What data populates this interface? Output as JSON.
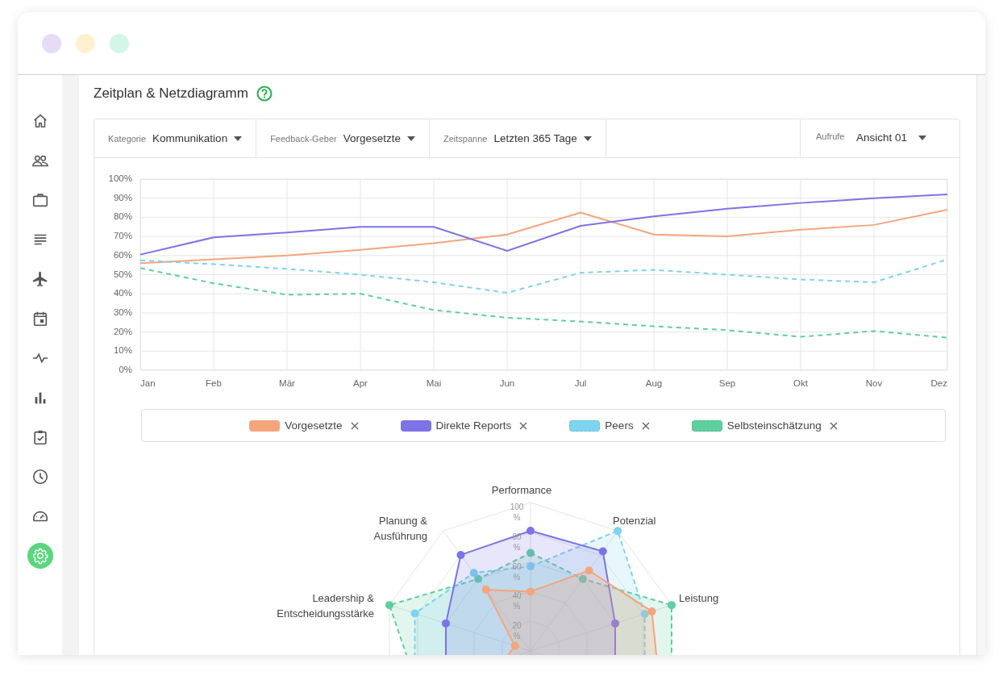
{
  "sidebar": {
    "items": [
      {
        "selected": false
      },
      {
        "selected": false
      },
      {
        "selected": false
      },
      {
        "selected": false
      },
      {
        "selected": false
      },
      {
        "selected": false
      },
      {
        "selected": false
      },
      {
        "selected": false
      },
      {
        "selected": false
      },
      {
        "selected": false
      },
      {
        "selected": false
      },
      {
        "selected": true
      }
    ]
  },
  "section": {
    "title": "Zeitplan & Netzdiagramm"
  },
  "filters": [
    {
      "label": "Kategorie",
      "value": "Kommunikation"
    },
    {
      "label": "Feedback-Geber",
      "value": "Vorgesetzte"
    },
    {
      "label": "Zeitspanne",
      "value": "Letzten 365 Tage"
    }
  ],
  "view_select": {
    "label": "Aufrufe",
    "value": "Ansicht 01"
  },
  "timeline": {
    "chart_data": {
      "type": "line",
      "categories": [
        "Jan",
        "Feb",
        "Mär",
        "Apr",
        "Mai",
        "Jun",
        "Jul",
        "Aug",
        "Sep",
        "Okt",
        "Nov",
        "Dez"
      ],
      "ylim": [
        0,
        100
      ],
      "grid": true,
      "yticks": [
        {
          "value": 0,
          "label": "0%"
        },
        {
          "value": 10,
          "label": "10%"
        },
        {
          "value": 20,
          "label": "20%"
        },
        {
          "value": 30,
          "label": "30%"
        },
        {
          "value": 40,
          "label": "40%"
        },
        {
          "value": 50,
          "label": "50%"
        },
        {
          "value": 60,
          "label": "60%"
        },
        {
          "value": 70,
          "label": "70%"
        },
        {
          "value": 80,
          "label": "80%"
        },
        {
          "value": 90,
          "label": "90%"
        },
        {
          "value": 100,
          "label": "100%"
        }
      ],
      "series": [
        {
          "name": "Vorgesetzte",
          "color": "#f4a57c",
          "line_style": "solid",
          "values": [
            56,
            58,
            60,
            63,
            66.5,
            71,
            82.5,
            71,
            70,
            73.5,
            76,
            84
          ]
        },
        {
          "name": "Direkte Reports",
          "color": "#7b73e6",
          "line_style": "solid",
          "values": [
            60.5,
            69.5,
            72,
            75,
            75,
            62.5,
            75.5,
            80.5,
            84.5,
            87.5,
            90,
            92
          ]
        },
        {
          "name": "Peers",
          "color": "#7dd3f0",
          "line_style": "dashed",
          "values": [
            57.5,
            55.5,
            53,
            50,
            46,
            40.5,
            51,
            52.5,
            50,
            47.5,
            46,
            58
          ]
        },
        {
          "name": "Selbsteinschätzung",
          "color": "#5fcf9e",
          "line_style": "dashed",
          "values": [
            53.5,
            45.5,
            39.5,
            40,
            31.5,
            27.5,
            25.5,
            23,
            21,
            17.5,
            20.5,
            17
          ]
        }
      ]
    }
  },
  "radar": {
    "axes": [
      "Performance",
      "Potenzial",
      "Leistung",
      "Planung & Ausführung",
      "Leadership & Entscheidungsstärke"
    ],
    "ticks": [
      "100 %",
      "80 %",
      "60 %",
      "40 %",
      "20 %"
    ]
  }
}
